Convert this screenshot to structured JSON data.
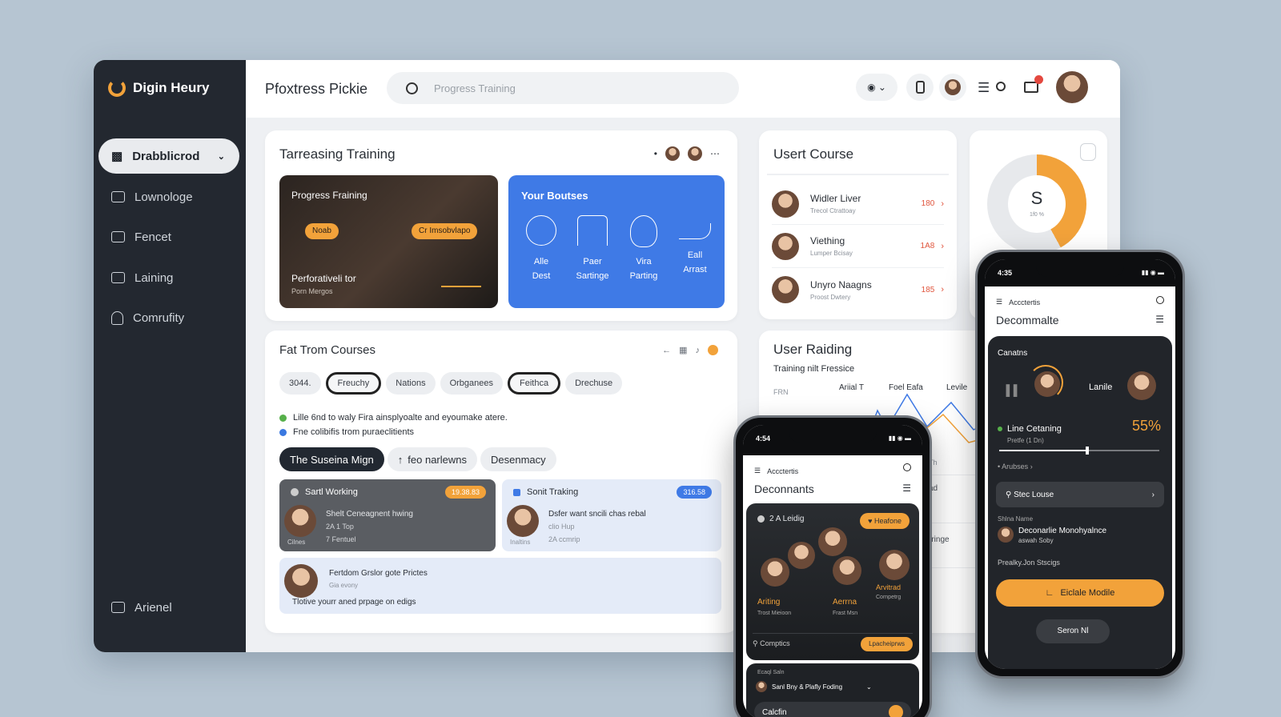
{
  "app": {
    "brand": "Digin Heury",
    "page_title": "Pfoxtress Pickie",
    "search_placeholder": "Progress Training"
  },
  "sidebar": {
    "items": [
      {
        "label": "Drabblicrod",
        "active": true
      },
      {
        "label": "Lownologe"
      },
      {
        "label": "Fencet"
      },
      {
        "label": "Laining"
      },
      {
        "label": "Comrufity"
      }
    ],
    "bottom_label": "Arienel"
  },
  "training": {
    "title": "Tarreasing Training",
    "left_card": {
      "title": "Progress Fraining",
      "badge1": "Noab",
      "badge2": "Cr Imsobvlapo",
      "caption": "Perforativeli tor",
      "sub": "Porn Mergos"
    },
    "right_card": {
      "title": "Your Boutses",
      "items": [
        {
          "l1": "Alle",
          "l2": "Dest"
        },
        {
          "l1": "Paer",
          "l2": "Sartinge"
        },
        {
          "l1": "Vira",
          "l2": "Parting"
        },
        {
          "l1": "Eall",
          "l2": "Arrast"
        }
      ]
    }
  },
  "user_course": {
    "title": "Usert Course",
    "rows": [
      {
        "name": "Widler Liver",
        "sub": "Trecol Ctrattoay",
        "value": "180"
      },
      {
        "name": "Viething",
        "sub": "Lumper Bcisay",
        "value": "1A8"
      },
      {
        "name": "Unyro Naagns",
        "sub": "Proost Dwtery",
        "value": "185"
      }
    ]
  },
  "gauge": {
    "letter": "S",
    "sub": "1f0 %",
    "percent": 0.42,
    "accent": "#f2a23a"
  },
  "courses": {
    "title": "Fat Trom Courses",
    "chips": [
      "3044.",
      "Freuchy",
      "Nations",
      "Orbganees",
      "Feithca",
      "Drechuse"
    ],
    "legend": [
      {
        "text": "Lille 6nd to waly Fira ainsplyoalte and eyoumake atere.",
        "color": "#56b04a"
      },
      {
        "text": "Fne colibifis trom puraeclitients",
        "color": "#3a78e0"
      }
    ],
    "tabs": [
      "The Suseina Mign",
      "feo narlewns",
      "Desenmacy"
    ],
    "item1": {
      "title": "Sartl Working",
      "badge": "19.38.83",
      "line1": "Shelt Ceneagnent hwing",
      "line2": "2A 1 Top",
      "line3": "7 Fentuel",
      "who": "Cilnes"
    },
    "item2": {
      "title": "Sonit Traking",
      "badge": "316.58",
      "line1": "Dsfer want sncili chas rebal",
      "line2": "clio Hup",
      "line3": "2A ccmrip",
      "who": "Inaltins"
    },
    "item3": {
      "title": "Fertdom Grslor gote Prictes",
      "line1": "Gia evony",
      "line2": "Tlotive yourr aned prpage on edigs"
    }
  },
  "user_rating": {
    "title": "User Raiding",
    "subtitle": "Training nilt Fressice",
    "axis": "FRN",
    "series": [
      "Ariial T",
      "Foel Eafa",
      "Levile"
    ],
    "side_labels": [
      "Th",
      "ad",
      "rringe"
    ]
  },
  "phone_small": {
    "time": "4:54",
    "header": "Accctertis",
    "title": "Deconnants",
    "tag": "2 A Leidig",
    "badge": "Heafone",
    "people": [
      {
        "name": "Ariting",
        "sub": "Trost Mieioon"
      },
      {
        "name": "Aerrna",
        "sub": "Frast Msn"
      },
      {
        "name": "Arvitrad",
        "sub": "Cornpetrg"
      }
    ],
    "search": "Comptics",
    "search_btn": "Lpacheiprws",
    "section": "Ecaql Saln",
    "row": "Sanl Bny & Plafly Foding",
    "bottom": "Calcfin"
  },
  "phone_big": {
    "time": "4:35",
    "header": "Accctertis",
    "title": "Decommalte",
    "card_title": "Canatns",
    "person": "Lanile",
    "metric_label": "Line Cetaning",
    "metric_value": "55%",
    "metric_sub": "Pretfe (1 Dn)",
    "link": "Arubses",
    "button1": "Stec Louse",
    "section": "Shlna Name",
    "entry": "Deconarlie Monohyalnce",
    "entry_sub": "aswah Soby",
    "note": "Prealky.Jon Stscigs",
    "cta": "Eiclale Modile",
    "cta2": "Seron Nl",
    "slider_value": 0.55
  }
}
